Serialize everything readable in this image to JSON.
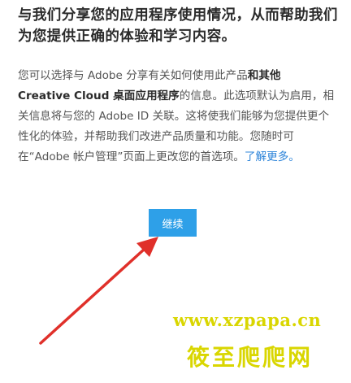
{
  "dialog": {
    "heading": "与我们分享您的应用程序使用情况，从而帮助我们为您提供正确的体验和学习内容。",
    "body_part1": "您可以选择与 Adobe 分享有关如何使用此产品",
    "body_bold": "和其他 Creative Cloud 桌面应用程序",
    "body_part2": "的信息。此选项默认为启用，相关信息将与您的 Adobe ID 关联。这将使我们能够为您提供更个性化的体验，并帮助我们改进产品质量和功能。您随时可在“Adobe 帐户管理”页面上更改您的首选项。",
    "learn_more": "了解更多。",
    "continue_label": "继续"
  },
  "watermark": {
    "url": "www.xzpapa.cn",
    "name": "筱至爬爬网"
  },
  "colors": {
    "button": "#2ea0e8",
    "link": "#2d84d9",
    "arrow": "#e0302a",
    "watermark": "#d9d600"
  },
  "icons": {
    "annotation": "red-arrow-icon"
  }
}
